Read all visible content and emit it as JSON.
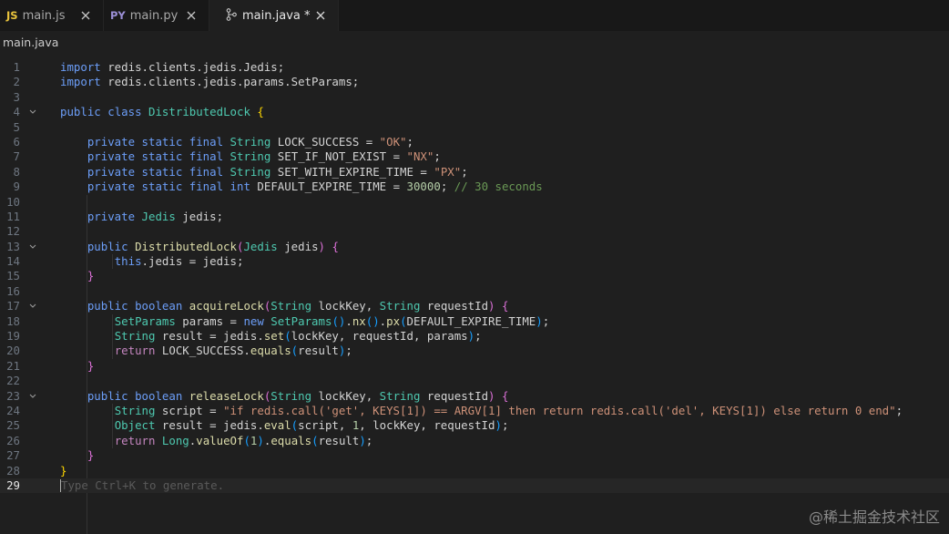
{
  "tabs": [
    {
      "icon": "JS",
      "icon_color": "#e8c33c",
      "label": "main.js",
      "close": "✕"
    },
    {
      "icon": "PY",
      "icon_color": "#9b8fd6",
      "label": "main.py",
      "close": "✕"
    },
    {
      "icon": "",
      "icon_color": "#c8c8c8",
      "label": "main.java *",
      "close": "✕"
    }
  ],
  "breadcrumb": "main.java",
  "hint": "Type Ctrl+K to generate.",
  "current_line": 29,
  "watermark": "@稀土掘金技术社区",
  "code_lines": [
    {
      "n": "1",
      "fold": "",
      "html": "<span class='kw'>import</span> redis.clients.jedis.Jedis;"
    },
    {
      "n": "2",
      "fold": "",
      "html": "<span class='kw'>import</span> redis.clients.jedis.params.SetParams;"
    },
    {
      "n": "3",
      "fold": "",
      "html": ""
    },
    {
      "n": "4",
      "fold": "v",
      "html": "<span class='kw'>public</span> <span class='kw'>class</span> <span class='ty'>DistributedLock</span> <span class='br'>{</span>"
    },
    {
      "n": "5",
      "fold": "",
      "html": ""
    },
    {
      "n": "6",
      "fold": "",
      "html": "    <span class='kw'>private</span> <span class='kw'>static</span> <span class='kw'>final</span> <span class='ty'>String</span> LOCK_SUCCESS = <span class='st'>\"OK\"</span>;"
    },
    {
      "n": "7",
      "fold": "",
      "html": "    <span class='kw'>private</span> <span class='kw'>static</span> <span class='kw'>final</span> <span class='ty'>String</span> SET_IF_NOT_EXIST = <span class='st'>\"NX\"</span>;"
    },
    {
      "n": "8",
      "fold": "",
      "html": "    <span class='kw'>private</span> <span class='kw'>static</span> <span class='kw'>final</span> <span class='ty'>String</span> SET_WITH_EXPIRE_TIME = <span class='st'>\"PX\"</span>;"
    },
    {
      "n": "9",
      "fold": "",
      "html": "    <span class='kw'>private</span> <span class='kw'>static</span> <span class='kw'>final</span> <span class='kw'>int</span> DEFAULT_EXPIRE_TIME = <span class='nm'>30000</span>; <span class='cm'>// 30 seconds</span>"
    },
    {
      "n": "10",
      "fold": "",
      "html": ""
    },
    {
      "n": "11",
      "fold": "",
      "html": "    <span class='kw'>private</span> <span class='ty'>Jedis</span> jedis;"
    },
    {
      "n": "12",
      "fold": "",
      "html": ""
    },
    {
      "n": "13",
      "fold": "v",
      "html": "    <span class='kw'>public</span> <span class='fn'>DistributedLock</span><span class='br2'>(</span><span class='ty'>Jedis</span> jedis<span class='br2'>)</span> <span class='br2'>{</span>"
    },
    {
      "n": "14",
      "fold": "",
      "html": "        <span class='kw'>this</span>.jedis = jedis;"
    },
    {
      "n": "15",
      "fold": "",
      "html": "    <span class='br2'>}</span>"
    },
    {
      "n": "16",
      "fold": "",
      "html": ""
    },
    {
      "n": "17",
      "fold": "v",
      "html": "    <span class='kw'>public</span> <span class='kw'>boolean</span> <span class='fn'>acquireLock</span><span class='br2'>(</span><span class='ty'>String</span> lockKey, <span class='ty'>String</span> requestId<span class='br2'>)</span> <span class='br2'>{</span>"
    },
    {
      "n": "18",
      "fold": "",
      "html": "        <span class='ty'>SetParams</span> params = <span class='kw'>new</span> <span class='ty'>SetParams</span><span class='br3'>()</span>.<span class='fn'>nx</span><span class='br3'>()</span>.<span class='fn'>px</span><span class='br3'>(</span>DEFAULT_EXPIRE_TIME<span class='br3'>)</span>;"
    },
    {
      "n": "19",
      "fold": "",
      "html": "        <span class='ty'>String</span> result = jedis.<span class='fn'>set</span><span class='br3'>(</span>lockKey, requestId, params<span class='br3'>)</span>;"
    },
    {
      "n": "20",
      "fold": "",
      "html": "        <span class='kw2'>return</span> LOCK_SUCCESS.<span class='fn'>equals</span><span class='br3'>(</span>result<span class='br3'>)</span>;"
    },
    {
      "n": "21",
      "fold": "",
      "html": "    <span class='br2'>}</span>"
    },
    {
      "n": "22",
      "fold": "",
      "html": ""
    },
    {
      "n": "23",
      "fold": "v",
      "html": "    <span class='kw'>public</span> <span class='kw'>boolean</span> <span class='fn'>releaseLock</span><span class='br2'>(</span><span class='ty'>String</span> lockKey, <span class='ty'>String</span> requestId<span class='br2'>)</span> <span class='br2'>{</span>"
    },
    {
      "n": "24",
      "fold": "",
      "html": "        <span class='ty'>String</span> script = <span class='st'>\"if redis.call('get', KEYS[1]) == ARGV[1] then return redis.call('del', KEYS[1]) else return 0 end\"</span>;"
    },
    {
      "n": "25",
      "fold": "",
      "html": "        <span class='ty'>Object</span> result = jedis.<span class='fn'>eval</span><span class='br3'>(</span>script, <span class='nm'>1</span>, lockKey, requestId<span class='br3'>)</span>;"
    },
    {
      "n": "26",
      "fold": "",
      "html": "        <span class='kw2'>return</span> <span class='ty'>Long</span>.<span class='fn'>valueOf</span><span class='br3'>(</span><span class='nm'>1</span><span class='br3'>)</span>.<span class='fn'>equals</span><span class='br3'>(</span>result<span class='br3'>)</span>;"
    },
    {
      "n": "27",
      "fold": "",
      "html": "    <span class='br2'>}</span>"
    },
    {
      "n": "28",
      "fold": "",
      "html": "<span class='br'>}</span>"
    },
    {
      "n": "29",
      "fold": "",
      "html": ""
    }
  ]
}
